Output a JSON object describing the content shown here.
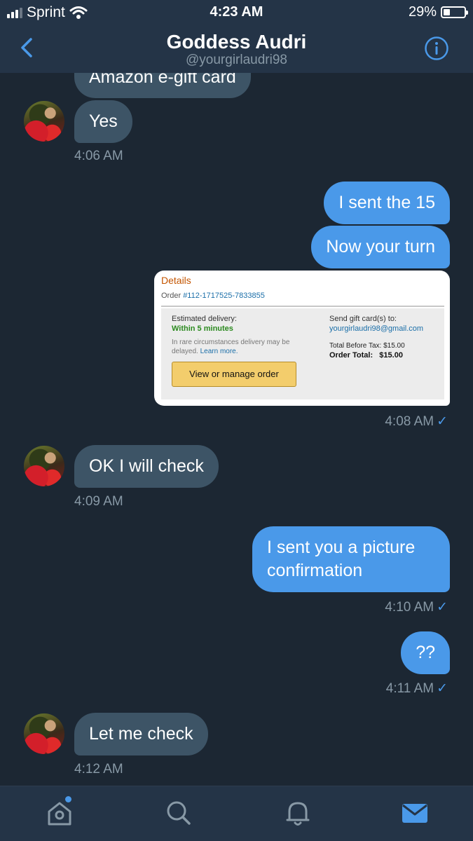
{
  "status_bar": {
    "carrier": "Sprint",
    "time": "4:23 AM",
    "battery": "29%",
    "battery_level": 0.29
  },
  "nav": {
    "title": "Goddess Audri",
    "handle": "@yourgirlaudri98",
    "back_icon": "chevron-left-icon",
    "info_icon": "info-icon"
  },
  "messages": [
    {
      "from": "them",
      "text": "Amazon e-gift card"
    },
    {
      "from": "them",
      "text": "Yes",
      "time": "4:06 AM"
    },
    {
      "from": "me",
      "text": "I sent the 15"
    },
    {
      "from": "me",
      "text": "Now your turn"
    },
    {
      "from": "me",
      "type": "image",
      "time": "4:08 AM"
    },
    {
      "from": "them",
      "text": "OK I will check",
      "time": "4:09 AM"
    },
    {
      "from": "me",
      "text_line1": "I sent you a picture",
      "text_line2": "confirmation",
      "time": "4:10 AM"
    },
    {
      "from": "me",
      "text": "??",
      "time": "4:11 AM"
    },
    {
      "from": "them",
      "text": "Let me check",
      "time": "4:12 AM"
    }
  ],
  "receipt": {
    "details": "Details",
    "order_label": "Order ",
    "order_number": "#112-1717525-7833855",
    "estimated_delivery": "Estimated delivery:",
    "within": "Within 5 minutes",
    "rare": "In rare circumstances delivery may be delayed.",
    "learn_more": "Learn more.",
    "button": "View or manage order",
    "send_to": "Send gift card(s) to:",
    "email": "yourgirlaudri98@gmail.com",
    "total_before_tax": "Total Before Tax: $15.00",
    "order_total": "Order Total:   $15.00"
  },
  "tabbar": {
    "items": [
      "home-icon",
      "search-icon",
      "bell-icon",
      "mail-icon"
    ],
    "active": "mail-icon",
    "colors": {
      "active": "#4a99e9",
      "inactive": "#8899a6"
    }
  },
  "colors": {
    "background": "#1c2733",
    "header": "#243447",
    "incoming_bubble": "#3d5466",
    "outgoing_bubble": "#4a99e9"
  }
}
